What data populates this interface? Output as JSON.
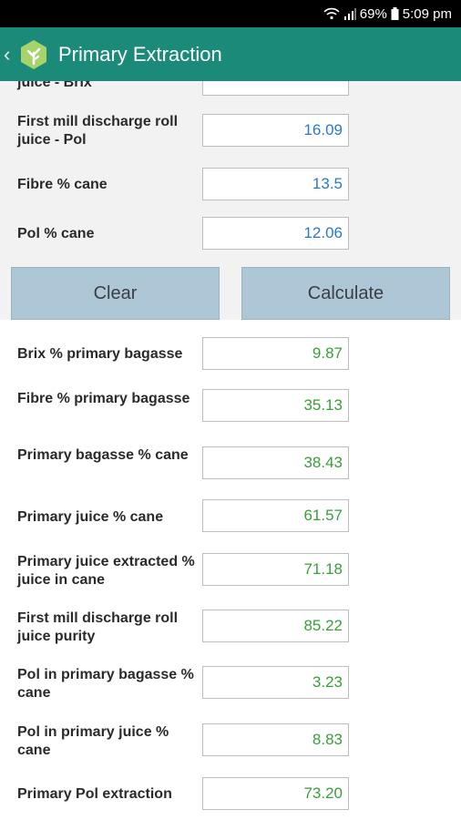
{
  "status_bar": {
    "battery": "69%",
    "time": "5:09 pm",
    "icons": [
      "wifi-icon",
      "signal-icon",
      "battery-icon"
    ]
  },
  "app_bar": {
    "title": "Primary Extraction",
    "icons": [
      "back-chevron-icon",
      "app-logo-icon"
    ]
  },
  "inputs": {
    "partial_label": "juice - Brix",
    "items": [
      {
        "label": "First mill discharge roll juice - Pol",
        "value": "16.09"
      },
      {
        "label": "Fibre % cane",
        "value": "13.5"
      },
      {
        "label": "Pol % cane",
        "value": "12.06"
      }
    ]
  },
  "buttons": {
    "clear": "Clear",
    "calculate": "Calculate"
  },
  "results": [
    {
      "label": "Brix % primary bagasse",
      "value": "9.87"
    },
    {
      "label": "Fibre % primary bagasse",
      "value": "35.13"
    },
    {
      "label": "Primary bagasse % cane",
      "value": "38.43"
    },
    {
      "label": "Primary juice % cane",
      "value": "61.57"
    },
    {
      "label": "Primary juice extracted % juice in cane",
      "value": "71.18"
    },
    {
      "label": "First mill discharge roll juice purity",
      "value": "85.22"
    },
    {
      "label": "Pol in primary bagasse % cane",
      "value": "3.23"
    },
    {
      "label": "Pol in primary juice % cane",
      "value": "8.83"
    },
    {
      "label": "Primary Pol extraction",
      "value": "73.20"
    }
  ],
  "colors": {
    "app_bar": "#1b8a78",
    "input_value": "#2979c9",
    "output_value": "#3a9e3a",
    "button": "#aec7d6"
  }
}
